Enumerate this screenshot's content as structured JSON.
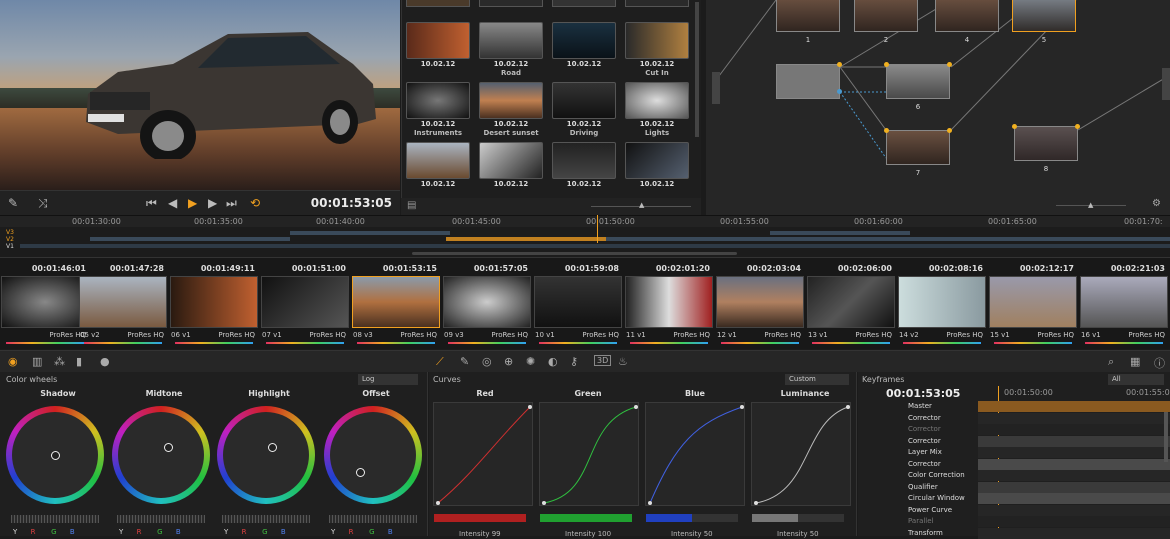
{
  "viewer": {
    "timecode": "00:01:53:05"
  },
  "media_pool": {
    "clips": [
      {
        "date": "10.02.12",
        "name": ""
      },
      {
        "date": "10.02.12",
        "name": "Road"
      },
      {
        "date": "10.02.12",
        "name": ""
      },
      {
        "date": "10.02.12",
        "name": "Cut In"
      },
      {
        "date": "10.02.12",
        "name": "Instruments"
      },
      {
        "date": "10.02.12",
        "name": "Desert sunset"
      },
      {
        "date": "10.02.12",
        "name": "Driving"
      },
      {
        "date": "10.02.12",
        "name": "Lights"
      },
      {
        "date": "10.02.12",
        "name": ""
      },
      {
        "date": "10.02.12",
        "name": ""
      },
      {
        "date": "10.02.12",
        "name": ""
      },
      {
        "date": "10.02.12",
        "name": ""
      }
    ]
  },
  "node_graph": {
    "labels": [
      "1",
      "2",
      "4",
      "5",
      "6",
      "7",
      "8"
    ]
  },
  "ruler": {
    "ticks": [
      "00:01:30:00",
      "00:01:35:00",
      "00:01:40:00",
      "00:01:45:00",
      "00:01:50:00",
      "00:01:55:00",
      "00:01:60:00",
      "00:01:65:00",
      "00:01:70:"
    ]
  },
  "tracks": {
    "labels": [
      "V3",
      "V2",
      "V1"
    ]
  },
  "strip": {
    "clips": [
      {
        "tc": "00:01:46:01",
        "num": "",
        "ver": "",
        "fmt": "ProRes HQ"
      },
      {
        "tc": "00:01:47:28",
        "num": "05",
        "ver": "v2",
        "fmt": "ProRes HQ"
      },
      {
        "tc": "00:01:49:11",
        "num": "06",
        "ver": "v1",
        "fmt": "ProRes HQ"
      },
      {
        "tc": "00:01:51:00",
        "num": "07",
        "ver": "v1",
        "fmt": "ProRes HQ"
      },
      {
        "tc": "00:01:53:15",
        "num": "08",
        "ver": "v3",
        "fmt": "ProRes HQ"
      },
      {
        "tc": "00:01:57:05",
        "num": "09",
        "ver": "v3",
        "fmt": "ProRes HQ"
      },
      {
        "tc": "00:01:59:08",
        "num": "10",
        "ver": "v1",
        "fmt": "ProRes HQ"
      },
      {
        "tc": "00:02:01:20",
        "num": "11",
        "ver": "v1",
        "fmt": "ProRes HQ"
      },
      {
        "tc": "00:02:03:04",
        "num": "12",
        "ver": "v1",
        "fmt": "ProRes HQ"
      },
      {
        "tc": "00:02:06:00",
        "num": "13",
        "ver": "v1",
        "fmt": "ProRes HQ"
      },
      {
        "tc": "00:02:08:16",
        "num": "14",
        "ver": "v2",
        "fmt": "ProRes HQ"
      },
      {
        "tc": "00:02:12:17",
        "num": "15",
        "ver": "v1",
        "fmt": "ProRes HQ"
      },
      {
        "tc": "00:02:21:03",
        "num": "16",
        "ver": "v1",
        "fmt": "ProRes HQ"
      }
    ]
  },
  "wheels": {
    "title": "Color wheels",
    "mode": "Log",
    "names": [
      "Shadow",
      "Midtone",
      "Highlight",
      "Offset"
    ],
    "channels": [
      "Y",
      "R",
      "G",
      "B"
    ]
  },
  "curves": {
    "title": "Curves",
    "mode": "Custom",
    "names": [
      "Red",
      "Green",
      "Blue",
      "Luminance"
    ],
    "intensity": [
      "Intensity 99",
      "Intensity 100",
      "Intensity 50",
      "Intensity 50"
    ]
  },
  "keyframes": {
    "title": "Keyframes",
    "filter": "All",
    "timecode": "00:01:53:05",
    "ruler_start": "00:01:50:00",
    "ruler_end": "00:01:55:00",
    "rows": [
      "Master",
      "Corrector",
      "Corrector",
      "Corrector",
      "Layer Mix",
      "Corrector",
      "Color Correction",
      "Qualifier",
      "Circular Window",
      "Power Curve",
      "Parallel",
      "Transform"
    ]
  },
  "colors": {
    "accent": "#f0a020"
  }
}
